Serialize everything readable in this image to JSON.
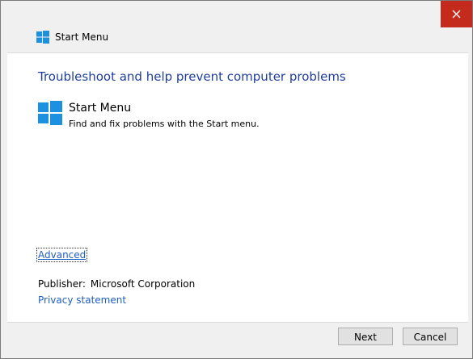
{
  "window": {
    "title": "Start Menu"
  },
  "content": {
    "heading": "Troubleshoot and help prevent computer problems",
    "item": {
      "title": "Start Menu",
      "description": "Find and fix problems with the Start menu."
    },
    "advanced_link": "Advanced",
    "publisher_label": "Publisher:",
    "publisher_value": "Microsoft Corporation",
    "privacy_link": "Privacy statement"
  },
  "buttons": {
    "next": "Next",
    "cancel": "Cancel"
  },
  "icons": {
    "close": "close-icon",
    "windows_logo": "windows-logo-icon"
  },
  "colors": {
    "close_button": "#c42b1c",
    "heading": "#1f3f9f",
    "link": "#1f5fbf",
    "windows_logo": "#1e90e0"
  }
}
